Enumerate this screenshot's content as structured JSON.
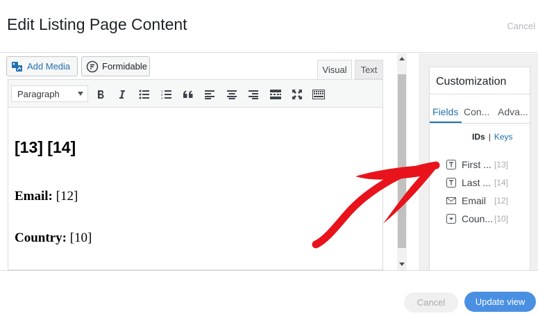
{
  "modal": {
    "title": "Edit Listing Page Content",
    "cancel_link": "Cancel"
  },
  "editor": {
    "add_media_label": "Add Media",
    "formidable_label": "Formidable",
    "tabs": [
      {
        "label": "Visual",
        "active": true
      },
      {
        "label": "Text",
        "active": false
      }
    ],
    "toolbar": {
      "format_select": "Paragraph",
      "buttons": [
        "bold-icon",
        "italic-icon",
        "bullet-list-icon",
        "numbered-list-icon",
        "blockquote-icon",
        "align-left-icon",
        "align-center-icon",
        "align-right-icon",
        "insert-more-icon",
        "fullscreen-icon",
        "toolbar-toggle-icon"
      ]
    },
    "content": {
      "heading": "[13] [14]",
      "lines": [
        {
          "label": "Email:",
          "value": " [12]"
        },
        {
          "label": "Country:",
          "value": " [10]"
        }
      ]
    }
  },
  "sidebar": {
    "title": "Customization",
    "tabs": [
      {
        "label": "Fields",
        "active": true
      },
      {
        "label": "Con...",
        "active": false
      },
      {
        "label": "Adva...",
        "active": false
      }
    ],
    "ids_label": "IDs",
    "separator": "|",
    "keys_label": "Keys",
    "fields": [
      {
        "name": "First ...",
        "id": "[13]",
        "icon": "text-field-icon"
      },
      {
        "name": "Last ...",
        "id": "[14]",
        "icon": "text-field-icon"
      },
      {
        "name": "Email",
        "id": "[12]",
        "icon": "email-field-icon"
      },
      {
        "name": "Coun...",
        "id": "[10]",
        "icon": "dropdown-field-icon"
      }
    ]
  },
  "footer": {
    "cancel_label": "Cancel",
    "update_label": "Update view"
  },
  "colors": {
    "accent": "#2271b1",
    "update_button": "#4a90e2",
    "annotation_arrow": "#e8131b"
  }
}
